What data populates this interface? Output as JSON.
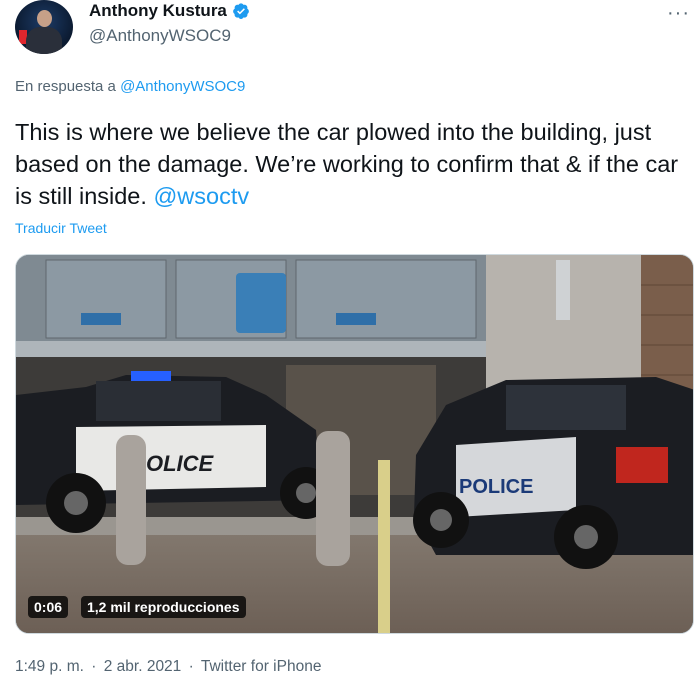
{
  "author": {
    "display_name": "Anthony Kustura",
    "handle": "@AnthonyWSOC9",
    "verified": true
  },
  "reply": {
    "prefix": "En respuesta a",
    "mention": "@AnthonyWSOC9"
  },
  "tweet": {
    "text": "This is where we believe the car plowed into the building, just based on the damage. We’re working to confirm that & if the car is still inside.",
    "mention": "@wsoctv"
  },
  "translate_label": "Traducir Tweet",
  "video": {
    "timecode": "0:06",
    "views": "1,2 mil reproducciones",
    "vehicle_text_left": "OLICE",
    "vehicle_text_right": "POLICE"
  },
  "meta": {
    "time": "1:49 p. m.",
    "date": "2 abr. 2021",
    "source": "Twitter for iPhone",
    "separator": "·"
  },
  "more_label": "···",
  "colors": {
    "accent": "#1d9bf0",
    "secondary_text": "#536471",
    "primary_text": "#0f1419"
  }
}
